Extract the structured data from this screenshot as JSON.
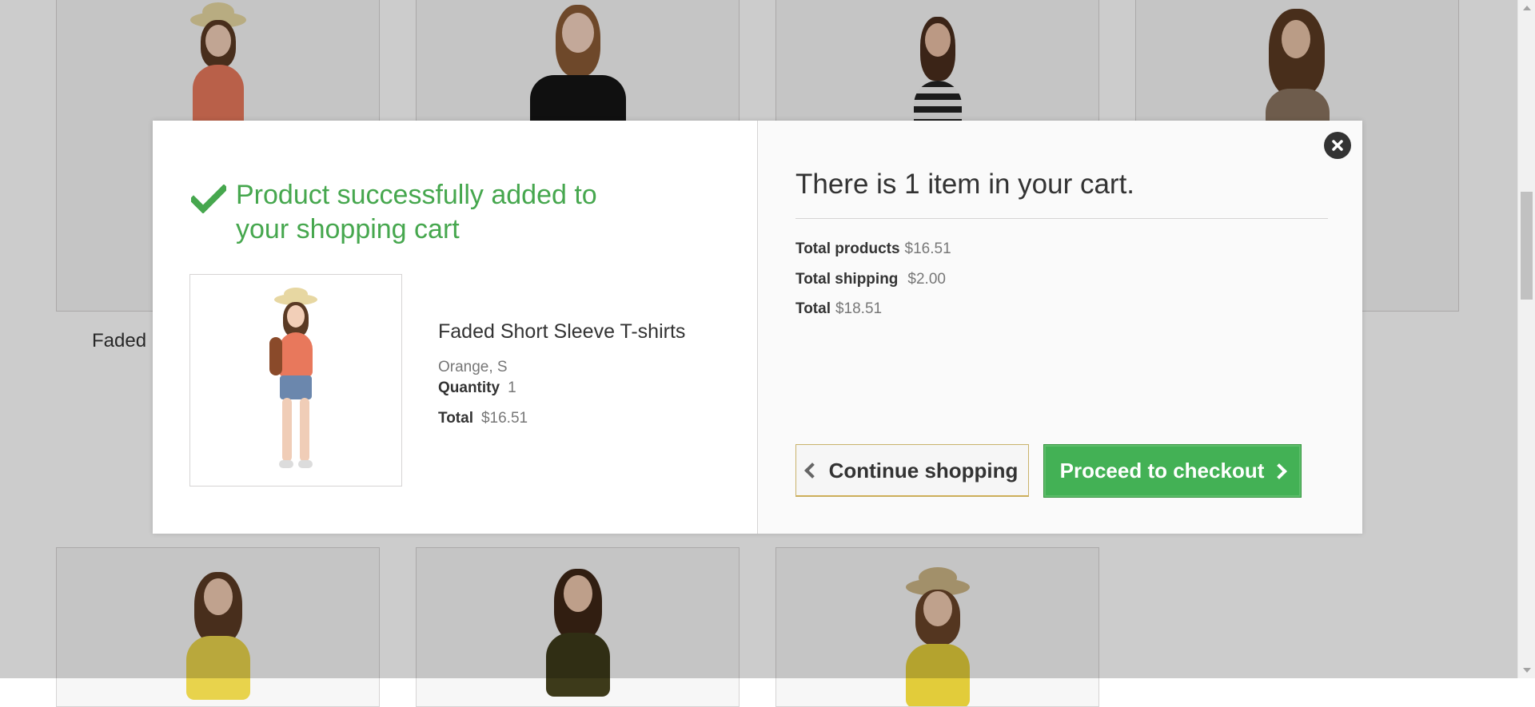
{
  "background": {
    "partial_product_name": "Faded"
  },
  "modal": {
    "success_message": "Product successfully added to your shopping cart",
    "product": {
      "name": "Faded Short Sleeve T-shirts",
      "attributes": "Orange, S",
      "quantity_label": "Quantity",
      "quantity_value": "1",
      "total_label": "Total",
      "total_value": "$16.51"
    },
    "cart": {
      "heading": "There is 1 item in your cart.",
      "total_products_label": "Total products",
      "total_products_value": "$16.51",
      "total_shipping_label": "Total shipping",
      "total_shipping_value": "$2.00",
      "total_label": "Total",
      "total_value": "$18.51"
    },
    "buttons": {
      "continue_label": "Continue shopping",
      "checkout_label": "Proceed to checkout"
    }
  },
  "colors": {
    "success_green": "#46a74e",
    "checkout_green": "#43b155",
    "text_dark": "#333333",
    "text_muted": "#777777"
  },
  "icons": [
    "check-icon",
    "close-icon",
    "chevron-left-icon",
    "chevron-right-icon"
  ]
}
